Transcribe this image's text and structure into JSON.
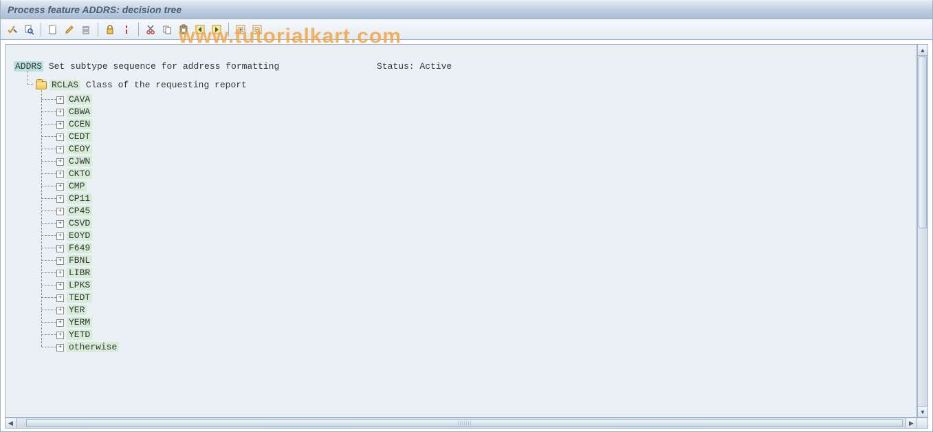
{
  "title": "Process feature ADDRS: decision tree",
  "toolbar": {
    "icons": [
      "check-wrench-icon",
      "search-doc-icon",
      "sep",
      "new-page-icon",
      "pencil-icon",
      "trash-icon",
      "sep",
      "lock-icon",
      "info-icon",
      "sep",
      "cut-icon",
      "copy-icon",
      "paste-icon",
      "nav-left-icon",
      "nav-right-icon",
      "sep",
      "expand-icon",
      "collapse-icon"
    ]
  },
  "watermark": "www.tutorialkart.com",
  "tree": {
    "root_key": "ADDRS",
    "root_desc": " Set subtype sequence for address formatting",
    "status_label": "Status: ",
    "status_value": "Active",
    "level1_key": "RCLAS",
    "level1_desc": " Class of the requesting report",
    "leaves": [
      "CAVA",
      "CBWA",
      "CCEN",
      "CEDT",
      "CEOY",
      "CJWN",
      "CKTO",
      "CMP",
      "CP11",
      "CP45",
      "CSVD",
      "EOYD",
      "F649",
      "FBNL",
      "LIBR",
      "LPKS",
      "TEDT",
      "YER",
      "YERM",
      "YETD",
      "otherwise"
    ]
  }
}
